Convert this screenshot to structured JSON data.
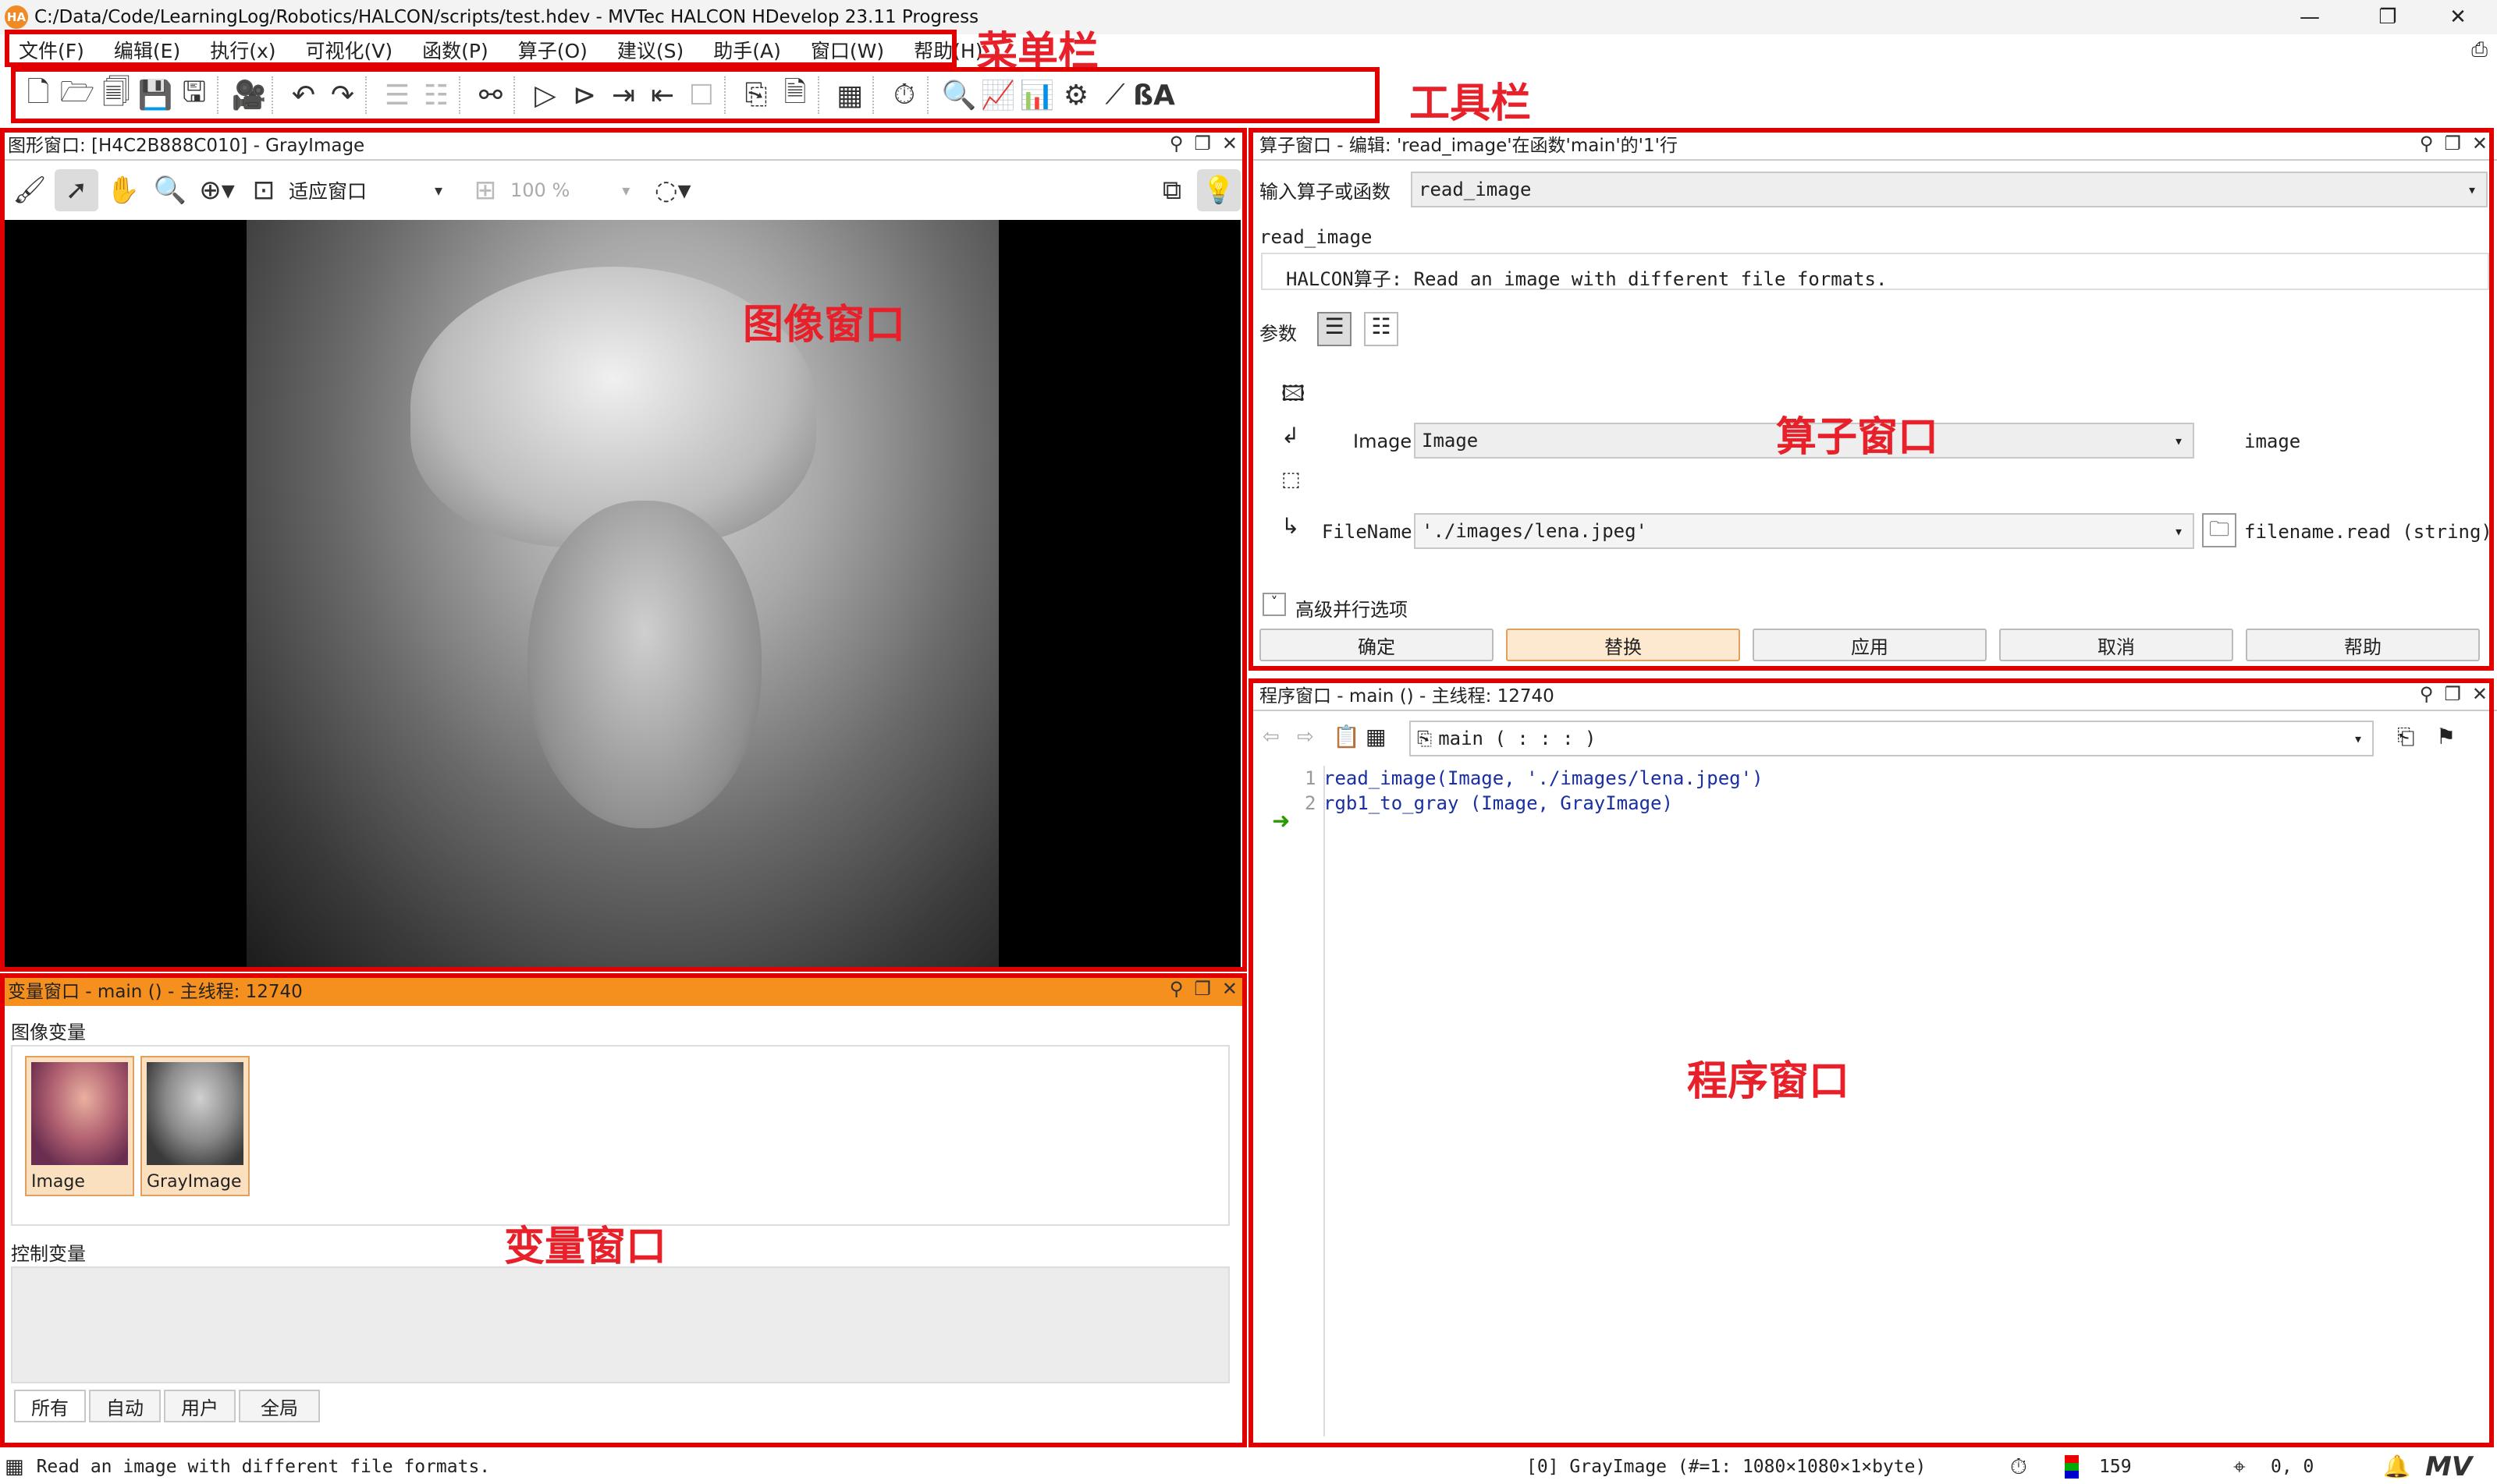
{
  "window": {
    "title": "C:/Data/Code/LearningLog/Robotics/HALCON/scripts/test.hdev - MVTec HALCON HDevelop 23.11 Progress",
    "logo": "HA",
    "minimize": "—",
    "maximize": "❐",
    "close": "✕"
  },
  "menu": [
    "文件(F)",
    "编辑(E)",
    "执行(x)",
    "可视化(V)",
    "函数(P)",
    "算子(O)",
    "建议(S)",
    "助手(A)",
    "窗口(W)",
    "帮助(H)"
  ],
  "annotations": {
    "menubar": "菜单栏",
    "toolbar": "工具栏",
    "image_window": "图像窗口",
    "operator_window": "算子窗口",
    "variable_window": "变量窗口",
    "program_window": "程序窗口"
  },
  "image_window": {
    "title": "图形窗口: [H4C2B888C010] - GrayImage",
    "fit_label": "适应窗口",
    "zoom": "100 %"
  },
  "operator_window": {
    "title": "算子窗口 - 编辑: 'read_image'在函数'main'的'1'行",
    "input_label": "输入算子或函数",
    "input_value": "read_image",
    "op_name": "read_image",
    "description": "HALCON算子: Read an image with different file formats.",
    "params_label": "参数",
    "param1_name": "Image",
    "param1_value": "Image",
    "param1_type": "image",
    "param2_name": "FileName",
    "param2_value": "'./images/lena.jpeg'",
    "param2_type": "filename.read (string)",
    "advanced": "高级并行选项",
    "buttons": {
      "ok": "确定",
      "replace": "替换",
      "apply": "应用",
      "cancel": "取消",
      "help": "帮助"
    }
  },
  "variable_window": {
    "title": "变量窗口 - main () - 主线程: 12740",
    "image_vars_label": "图像变量",
    "image_vars": [
      "Image",
      "GrayImage"
    ],
    "control_vars_label": "控制变量",
    "tabs": [
      "所有",
      "自动",
      "用户",
      "全局"
    ]
  },
  "program_window": {
    "title": "程序窗口 - main () - 主线程: 12740",
    "proc_select": "main ( : : : )",
    "lines": [
      {
        "num": "1",
        "code": "read_image(Image, './images/lena.jpeg')"
      },
      {
        "num": "2",
        "code": "rgb1_to_gray (Image, GrayImage)"
      }
    ]
  },
  "status": {
    "message": "Read an image with different file formats.",
    "image_info": "[0] GrayImage (#=1: 1080×1080×1×byte)",
    "gray_value": "159",
    "coords": "0, 0",
    "logo": "MV"
  },
  "colors": {
    "accent": "#f5901e",
    "annotation": "#e00000"
  }
}
